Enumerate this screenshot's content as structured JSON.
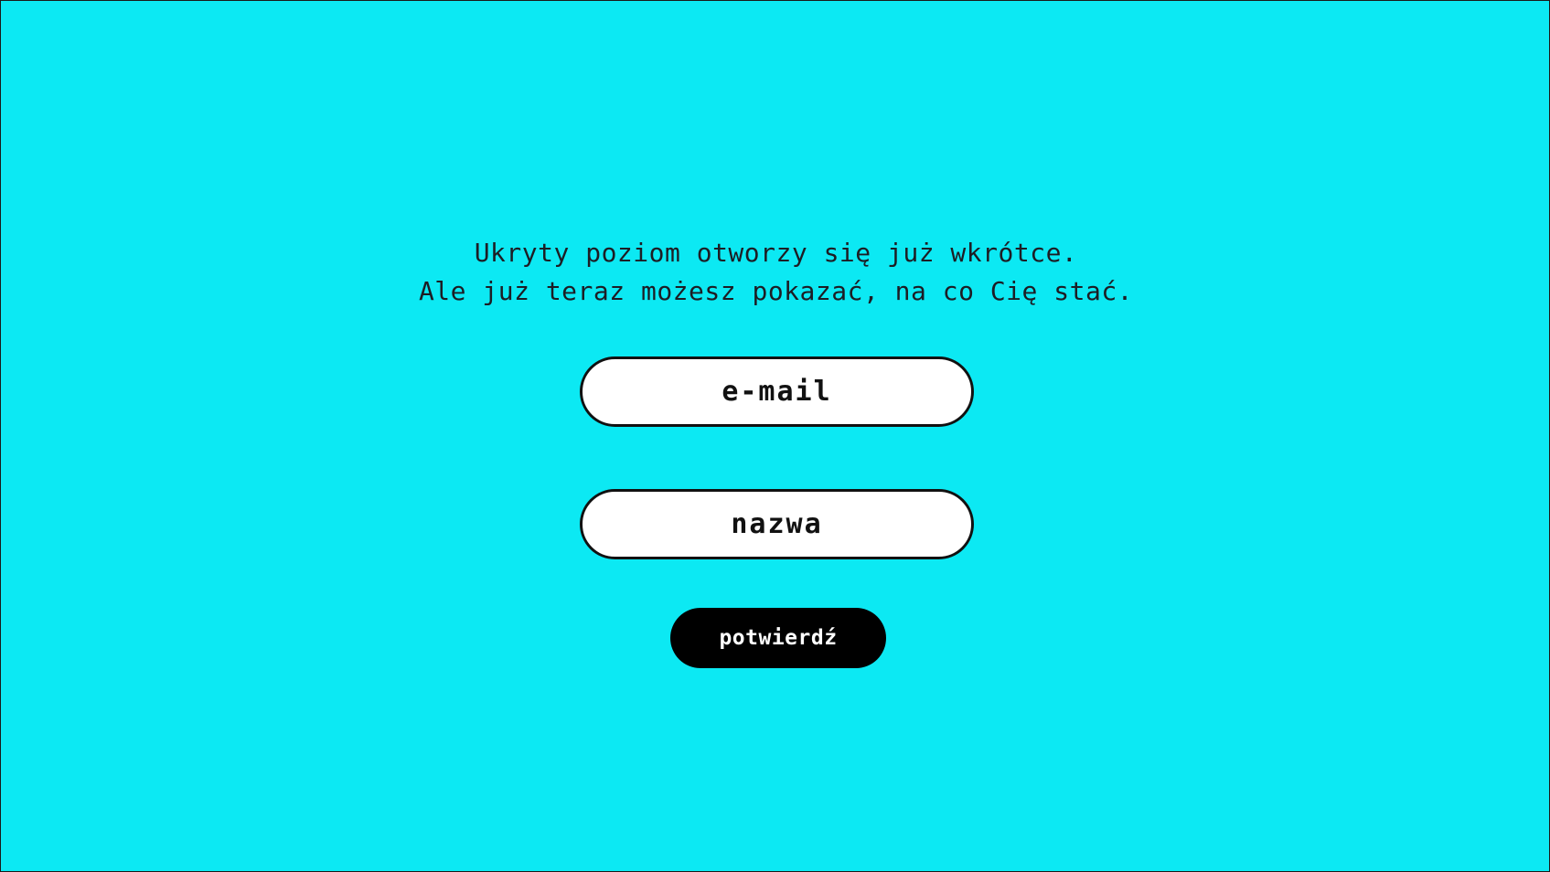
{
  "colors": {
    "background": "#0ce9f3",
    "field_background": "#ffffff",
    "field_border": "#111111",
    "button_background": "#000000",
    "button_text": "#ffffff"
  },
  "headline": {
    "line1": "Ukryty poziom otworzy się już wkrótce.",
    "line2": "Ale już teraz możesz pokazać, na co Cię stać."
  },
  "form": {
    "email": {
      "placeholder": "e-mail",
      "value": ""
    },
    "name": {
      "placeholder": "nazwa",
      "value": ""
    },
    "submit_label": "potwierdź"
  }
}
